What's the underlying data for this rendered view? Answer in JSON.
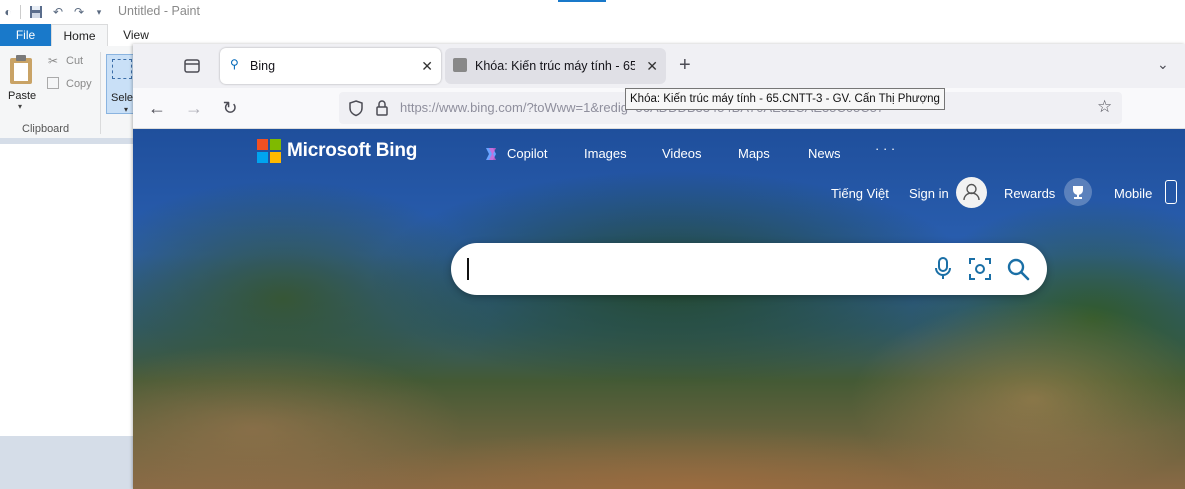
{
  "paint": {
    "title": "Untitled - Paint",
    "tabs": {
      "file": "File",
      "home": "Home",
      "view": "View"
    },
    "ribbon": {
      "paste": "Paste",
      "cut": "Cut",
      "copy": "Copy",
      "select": "Sele",
      "clipboard_group": "Clipboard"
    }
  },
  "browser": {
    "tabs": [
      {
        "label": "Bing",
        "active": true
      },
      {
        "label": "Khóa: Kiến trúc máy tính - 65.C"
      }
    ],
    "new_tab": "+",
    "tooltip": "Khóa: Kiến trúc máy tính - 65.CNTT-3 - GV. Cấn Thị Phượng",
    "url": "https://www.bing.com/?toWww=1&redig=56ADDDB33454BA70AE32CAE35C05C57"
  },
  "bing": {
    "brand": "Microsoft Bing",
    "nav": [
      "Copilot",
      "Images",
      "Videos",
      "Maps",
      "News",
      "· · ·"
    ],
    "language": "Tiếng Việt",
    "sign_in": "Sign in",
    "rewards": "Rewards",
    "mobile": "Mobile",
    "search_placeholder": ""
  },
  "colors": {
    "paint_file_tab": "#1979ca",
    "ms_logo": [
      "#f25022",
      "#7fba00",
      "#00a4ef",
      "#ffb900"
    ],
    "search_icon": "#1a6fa6"
  }
}
